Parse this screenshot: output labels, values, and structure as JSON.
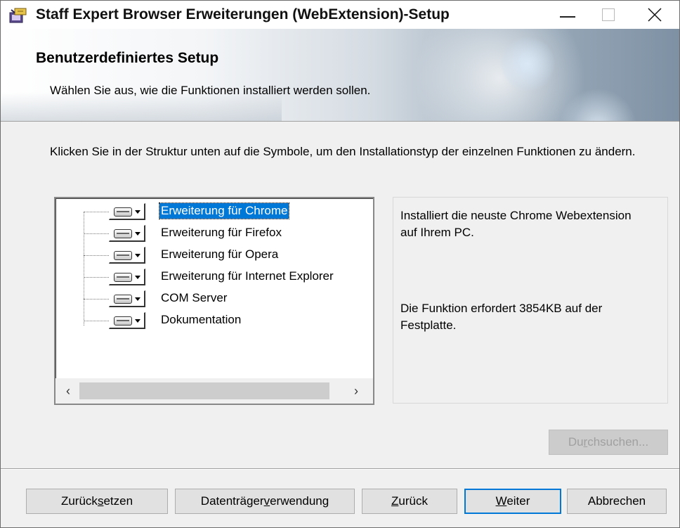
{
  "window": {
    "title": "Staff Expert Browser Erweiterungen (WebExtension)-Setup",
    "icon": "setup-installer-icon"
  },
  "banner": {
    "title": "Benutzerdefiniertes Setup",
    "subtitle": "Wählen Sie aus, wie die Funktionen installiert werden sollen."
  },
  "instructions": "Klicken Sie in der Struktur unten auf die Symbole, um den Installationstyp der einzelnen Funktionen zu ändern.",
  "features": [
    {
      "label": "Erweiterung für Chrome",
      "selected": true
    },
    {
      "label": "Erweiterung für Firefox",
      "selected": false
    },
    {
      "label": "Erweiterung für Opera",
      "selected": false
    },
    {
      "label": "Erweiterung für Internet Explorer",
      "selected": false
    },
    {
      "label": "COM Server",
      "selected": false
    },
    {
      "label": "Dokumentation",
      "selected": false
    }
  ],
  "description": {
    "text": "Installiert die neuste Chrome Webextension auf Ihrem PC.",
    "size": "Die Funktion erfordert 3854KB auf der Festplatte."
  },
  "buttons": {
    "browse": {
      "pre": "Du",
      "accel": "r",
      "post": "chsuchen..."
    },
    "reset": {
      "pre": "Zurück",
      "accel": "s",
      "post": "etzen"
    },
    "disk": {
      "pre": "Datenträger",
      "accel": "v",
      "post": "erwendung"
    },
    "back": {
      "pre": "",
      "accel": "Z",
      "post": "urück"
    },
    "next": {
      "pre": "",
      "accel": "W",
      "post": "eiter"
    },
    "cancel": {
      "pre": "",
      "accel": "",
      "post": "Abbrechen"
    }
  },
  "colors": {
    "selection": "#0078d7",
    "dialog_bg": "#f0f0f0"
  }
}
